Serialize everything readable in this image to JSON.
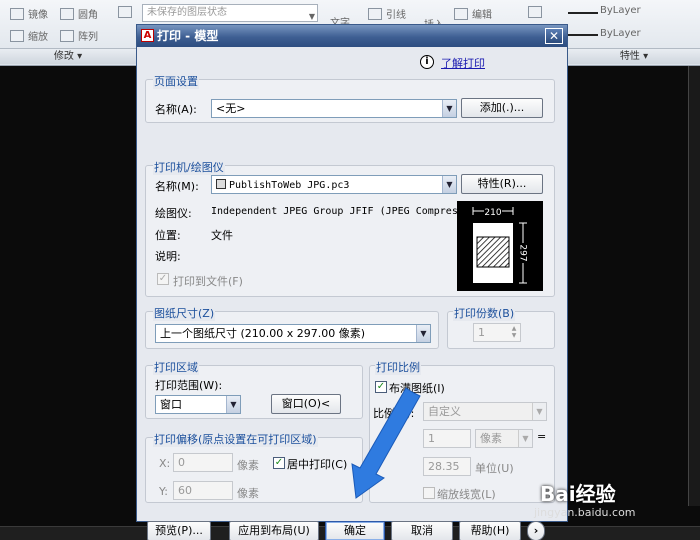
{
  "ribbon": {
    "mirror": "镜像",
    "fillet": "圆角",
    "scale": "缩放",
    "array": "阵列",
    "layer_state": "未保存的图层状态",
    "text": "文字",
    "leader": "引线",
    "insert": "插入",
    "edit": "编辑",
    "modify_panel": "修改",
    "properties_panel": "特性",
    "bylayer_1": "ByLayer",
    "bylayer_2": "ByLayer"
  },
  "dialog": {
    "title": "打印 - 模型",
    "learn_link": "了解打印",
    "page_setup": {
      "group_title": "页面设置",
      "name_label": "名称(A):",
      "name_value": "<无>",
      "add_button": "添加(.)..."
    },
    "printer": {
      "group_title": "打印机/绘图仪",
      "name_label": "名称(M):",
      "name_value": "PublishToWeb JPG.pc3",
      "properties_button": "特性(R)...",
      "plotter_label": "绘图仪:",
      "plotter_value": "Independent JPEG Group JFIF (JPEG Compressi...",
      "location_label": "位置:",
      "location_value": "文件",
      "description_label": "说明:",
      "print_to_file": "打印到文件(F)",
      "preview_width": "210",
      "preview_height": "297"
    },
    "paper_size": {
      "group_title": "图纸尺寸(Z)",
      "value": "上一个图纸尺寸  (210.00 x 297.00 像素)"
    },
    "copies": {
      "group_title": "打印份数(B)",
      "value": "1"
    },
    "plot_area": {
      "group_title": "打印区域",
      "range_label": "打印范围(W):",
      "range_value": "窗口",
      "window_button": "窗口(O)<"
    },
    "plot_scale": {
      "group_title": "打印比例",
      "fit_to_paper": "布满图纸(I)",
      "scale_label": "比例(S):",
      "scale_value": "自定义",
      "value1": "1",
      "unit1": "像素",
      "value2": "28.35",
      "unit2": "单位(U)",
      "scale_lineweights": "缩放线宽(L)",
      "equals": "="
    },
    "plot_offset": {
      "group_title": "打印偏移(原点设置在可打印区域)",
      "x_label": "X:",
      "x_value": "0",
      "x_unit": "像素",
      "y_label": "Y:",
      "y_value": "60",
      "y_unit": "像素",
      "center_plot": "居中打印(C)"
    },
    "buttons": {
      "preview": "预览(P)...",
      "apply_layout": "应用到布局(U)",
      "ok": "确定",
      "cancel": "取消",
      "help": "帮助(H)",
      "expand": "›"
    }
  },
  "watermark": {
    "brand": "Bai经验",
    "url": "jingyan.baidu.com"
  },
  "colors": {
    "arrow": "#2f7be0",
    "group_title": "#1b4f9c",
    "titlebar": "#3e5f93"
  }
}
